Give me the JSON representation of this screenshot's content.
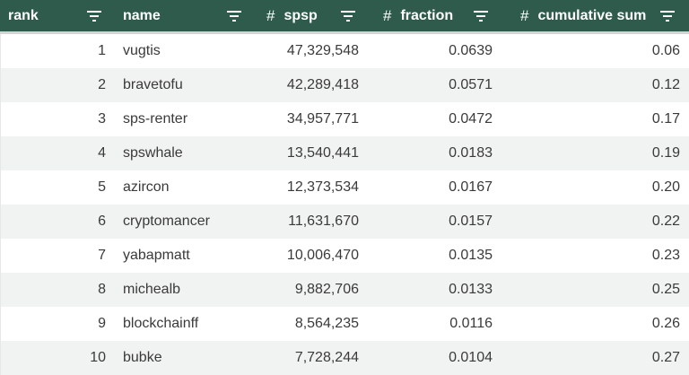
{
  "header": {
    "columns": [
      {
        "label": "rank",
        "numeric": false
      },
      {
        "label": "name",
        "numeric": false
      },
      {
        "label": "spsp",
        "numeric": true,
        "type_glyph": "#"
      },
      {
        "label": "fraction",
        "numeric": true,
        "type_glyph": "#"
      },
      {
        "label": "cumulative sum",
        "numeric": true,
        "type_glyph": "#"
      }
    ]
  },
  "rows": [
    {
      "rank": "1",
      "name": "vugtis",
      "spsp": "47,329,548",
      "fraction": "0.0639",
      "cumsum": "0.06"
    },
    {
      "rank": "2",
      "name": "bravetofu",
      "spsp": "42,289,418",
      "fraction": "0.0571",
      "cumsum": "0.12"
    },
    {
      "rank": "3",
      "name": "sps-renter",
      "spsp": "34,957,771",
      "fraction": "0.0472",
      "cumsum": "0.17"
    },
    {
      "rank": "4",
      "name": "spswhale",
      "spsp": "13,540,441",
      "fraction": "0.0183",
      "cumsum": "0.19"
    },
    {
      "rank": "5",
      "name": "azircon",
      "spsp": "12,373,534",
      "fraction": "0.0167",
      "cumsum": "0.20"
    },
    {
      "rank": "6",
      "name": "cryptomancer",
      "spsp": "11,631,670",
      "fraction": "0.0157",
      "cumsum": "0.22"
    },
    {
      "rank": "7",
      "name": "yabapmatt",
      "spsp": "10,006,470",
      "fraction": "0.0135",
      "cumsum": "0.23"
    },
    {
      "rank": "8",
      "name": "michealb",
      "spsp": "9,882,706",
      "fraction": "0.0133",
      "cumsum": "0.25"
    },
    {
      "rank": "9",
      "name": "blockchainff",
      "spsp": "8,564,235",
      "fraction": "0.0116",
      "cumsum": "0.26"
    },
    {
      "rank": "10",
      "name": "bubke",
      "spsp": "7,728,244",
      "fraction": "0.0104",
      "cumsum": "0.27"
    }
  ],
  "colors": {
    "header_bg": "#2e5b4b",
    "header_text": "#ffffff",
    "row_alt_bg": "#f1f3f2"
  },
  "icons": {
    "filter": "filter-icon",
    "numeric_type": "hash-icon"
  }
}
